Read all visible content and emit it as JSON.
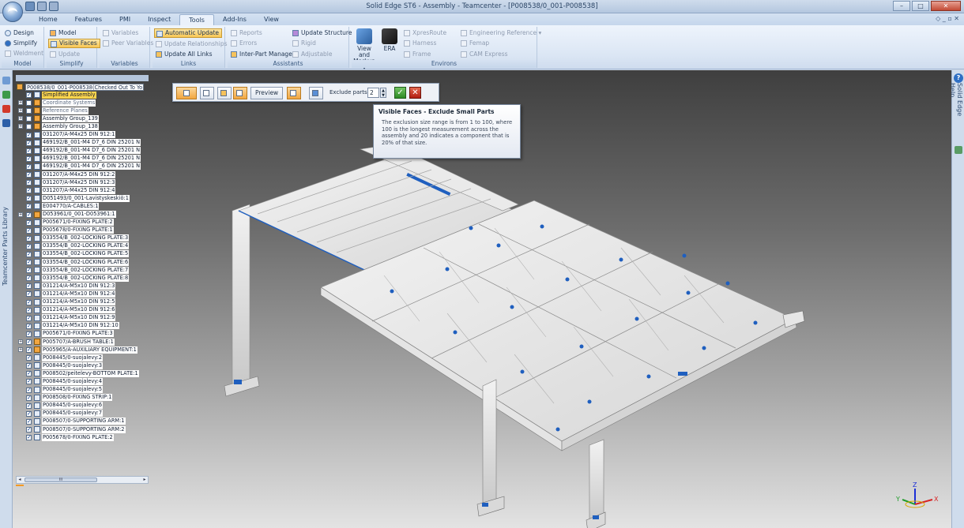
{
  "window": {
    "title": "Solid Edge ST6 - Assembly - Teamcenter - [P008538/0_001-P008538]",
    "controls": [
      "–",
      "□",
      "✕"
    ]
  },
  "ribbon": {
    "tabs": [
      "Home",
      "Features",
      "PMI",
      "Inspect",
      "Tools",
      "Add-Ins",
      "View"
    ],
    "active_tab": "Tools",
    "right_controls": "◇ _ ▫ ✕",
    "groups": {
      "model": {
        "label": "Model",
        "design": "Design",
        "simplify": "Simplify",
        "weldment": "Weldment"
      },
      "simplify": {
        "label": "Simplify",
        "model": "Model",
        "visible_faces": "Visible Faces",
        "update": "Update"
      },
      "variables": {
        "label": "Variables",
        "variables": "Variables",
        "peer_variables": "Peer Variables"
      },
      "links": {
        "label": "Links",
        "automatic_update": "Automatic Update",
        "update_relationships": "Update Relationships",
        "update_all_links": "Update All Links"
      },
      "assistants": {
        "label": "Assistants",
        "reports": "Reports",
        "errors": "Errors",
        "inter_part_manager": "Inter-Part Manager",
        "update_structure": "Update Structure",
        "rigid": "Rigid",
        "adjustable": "Adjustable"
      },
      "environs": {
        "label": "Environs",
        "view_and_markup": "View and Markup ▾",
        "era": "ERA",
        "xpresroute": "XpresRoute",
        "harness": "Harness",
        "frame": "Frame",
        "engineering_reference": "Engineering Reference ▾",
        "femap": "Femap",
        "cam_express": "CAM Express"
      }
    }
  },
  "left_strip": {
    "label": "Teamcenter Parts Library"
  },
  "right_strip": {
    "label": "Solid Edge Help"
  },
  "pathfinder": {
    "root": "P008538/0_001-P008538(Checked Out To Yo",
    "items": [
      {
        "label": "Simplified Assembly",
        "checked": true,
        "expander": "",
        "state": "hl"
      },
      {
        "label": "Coordinate Systems",
        "checked": false,
        "expander": "+",
        "state": "dim"
      },
      {
        "label": "Reference Planes",
        "checked": false,
        "expander": "+",
        "state": "dim"
      },
      {
        "label": "Assembly Group_139",
        "checked": false,
        "expander": "+",
        "state": ""
      },
      {
        "label": "Assembly Group_138",
        "checked": false,
        "expander": "+",
        "state": ""
      },
      {
        "label": "031207/A-M4x25 DIN 912:1",
        "checked": true,
        "expander": "",
        "state": ""
      },
      {
        "label": "469192/B_001-M4 D7_6 DIN 25201 N",
        "checked": true,
        "expander": "",
        "state": ""
      },
      {
        "label": "469192/B_001-M4 D7_6 DIN 25201 N",
        "checked": true,
        "expander": "",
        "state": ""
      },
      {
        "label": "469192/B_001-M4 D7_6 DIN 25201 N",
        "checked": true,
        "expander": "",
        "state": ""
      },
      {
        "label": "469192/B_001-M4 D7_6 DIN 25201 N",
        "checked": true,
        "expander": "",
        "state": ""
      },
      {
        "label": "031207/A-M4x25 DIN 912:2",
        "checked": true,
        "expander": "",
        "state": ""
      },
      {
        "label": "031207/A-M4x25 DIN 912:3",
        "checked": true,
        "expander": "",
        "state": ""
      },
      {
        "label": "031207/A-M4x25 DIN 912:4",
        "checked": true,
        "expander": "",
        "state": ""
      },
      {
        "label": "D051493/0_001-Lavistyskeskiö:1",
        "checked": true,
        "expander": "",
        "state": ""
      },
      {
        "label": "E004770/A-CABLES:1",
        "checked": true,
        "expander": "",
        "state": ""
      },
      {
        "label": "D053961/0_001-D053961:1",
        "checked": true,
        "expander": "+",
        "state": ""
      },
      {
        "label": "P005671/0-FIXING PLATE:2",
        "checked": true,
        "expander": "",
        "state": ""
      },
      {
        "label": "P005678/0-FIXING PLATE:1",
        "checked": true,
        "expander": "",
        "state": ""
      },
      {
        "label": "033554/B_002-LOCKING PLATE:3",
        "checked": true,
        "expander": "",
        "state": ""
      },
      {
        "label": "033554/B_002-LOCKING PLATE:4",
        "checked": true,
        "expander": "",
        "state": ""
      },
      {
        "label": "033554/B_002-LOCKING PLATE:5",
        "checked": true,
        "expander": "",
        "state": ""
      },
      {
        "label": "033554/B_002-LOCKING PLATE:6",
        "checked": true,
        "expander": "",
        "state": ""
      },
      {
        "label": "033554/B_002-LOCKING PLATE:7",
        "checked": true,
        "expander": "",
        "state": ""
      },
      {
        "label": "033554/B_002-LOCKING PLATE:8",
        "checked": true,
        "expander": "",
        "state": ""
      },
      {
        "label": "031214/A-M5x10 DIN 912:3",
        "checked": true,
        "expander": "",
        "state": ""
      },
      {
        "label": "031214/A-M5x10 DIN 912:4",
        "checked": true,
        "expander": "",
        "state": ""
      },
      {
        "label": "031214/A-M5x10 DIN 912:5",
        "checked": true,
        "expander": "",
        "state": ""
      },
      {
        "label": "031214/A-M5x10 DIN 912:6",
        "checked": true,
        "expander": "",
        "state": ""
      },
      {
        "label": "031214/A-M5x10 DIN 912:9",
        "checked": true,
        "expander": "",
        "state": ""
      },
      {
        "label": "031214/A-M5x10 DIN 912:10",
        "checked": true,
        "expander": "",
        "state": ""
      },
      {
        "label": "P005671/0-FIXING PLATE:3",
        "checked": true,
        "expander": "",
        "state": ""
      },
      {
        "label": "P005707/A-BRUSH TABLE:1",
        "checked": true,
        "expander": "+",
        "state": ""
      },
      {
        "label": "P005965/A-AUXILIARY EQUIPMENT:1",
        "checked": true,
        "expander": "+",
        "state": ""
      },
      {
        "label": "P008445/0-suojalevy:2",
        "checked": true,
        "expander": "",
        "state": ""
      },
      {
        "label": "P008445/0-suojalevy:3",
        "checked": true,
        "expander": "",
        "state": ""
      },
      {
        "label": "P008502/peitelevy-BOTTOM PLATE:1",
        "checked": true,
        "expander": "",
        "state": ""
      },
      {
        "label": "P008445/0-suojalevy:4",
        "checked": true,
        "expander": "",
        "state": ""
      },
      {
        "label": "P008445/0-suojalevy:5",
        "checked": true,
        "expander": "",
        "state": ""
      },
      {
        "label": "P008508/0-FIXING STRIP:1",
        "checked": true,
        "expander": "",
        "state": ""
      },
      {
        "label": "P008445/0-suojalevy:6",
        "checked": true,
        "expander": "",
        "state": ""
      },
      {
        "label": "P008445/0-suojalevy:7",
        "checked": true,
        "expander": "",
        "state": ""
      },
      {
        "label": "P008507/0-SUPPORTING ARM:1",
        "checked": true,
        "expander": "",
        "state": ""
      },
      {
        "label": "P008507/0-SUPPORTING ARM:2",
        "checked": true,
        "expander": "",
        "state": ""
      },
      {
        "label": "P005678/0-FIXING PLATE:2",
        "checked": true,
        "expander": "",
        "state": ""
      }
    ],
    "scroll_thumb": "III"
  },
  "command_bar": {
    "preview_label": "Preview",
    "exclude_parts_label": "Exclude parts:",
    "exclude_parts_value": "2",
    "ok_glyph": "✓",
    "cancel_glyph": "✕"
  },
  "tooltip": {
    "title": "Visible Faces - Exclude Small Parts",
    "body": "The exclusion size range is from 1 to 100, where 100 is the longest measurement across the assembly and 20 indicates a component that is 20% of that size."
  },
  "triad": {
    "x": "X",
    "y": "Y",
    "z": "Z"
  },
  "colors": {
    "accent": "#f2a640",
    "highlight": "#ffd54d",
    "ribbon": "#dbe6f4",
    "model_blue": "#1f5fbf"
  }
}
